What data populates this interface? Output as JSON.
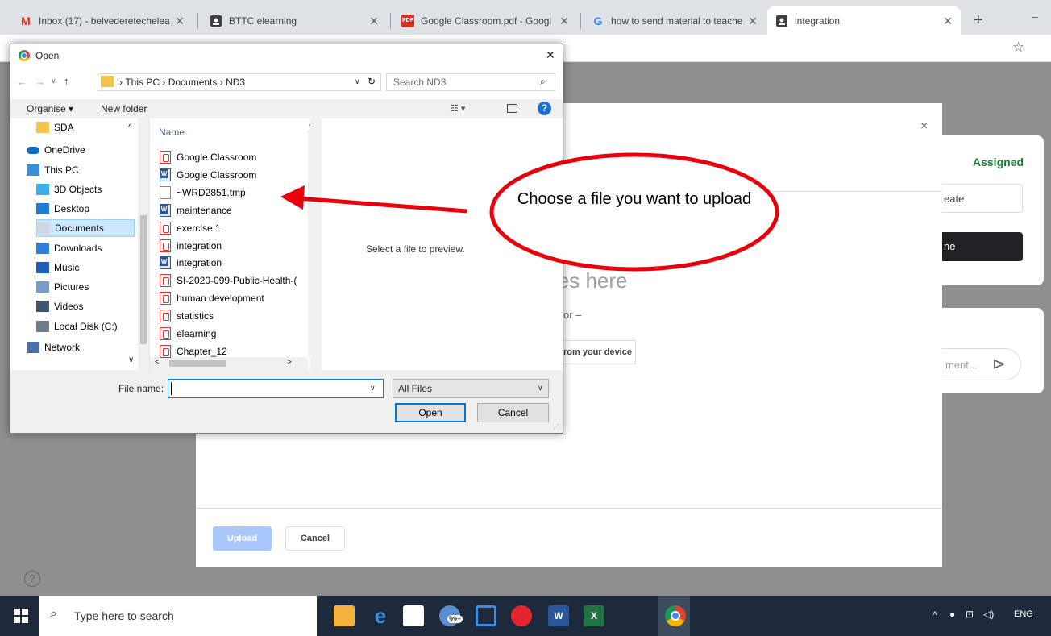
{
  "browser": {
    "tabs": [
      {
        "label": "Inbox (17) - belvederetechelea",
        "icon": "gmail-icon"
      },
      {
        "label": "BTTC elearning",
        "icon": "classroom-icon"
      },
      {
        "label": "Google Classroom.pdf - Googl",
        "icon": "pdf-icon"
      },
      {
        "label": "how to send material to teache",
        "icon": "google-icon"
      },
      {
        "label": "integration",
        "icon": "classroom-icon"
      }
    ],
    "new_tab": "+",
    "minimize": "–",
    "star": "☆"
  },
  "classroom": {
    "assigned": "Assigned",
    "create_partial": "eate",
    "done_partial": "ne",
    "drag_partial": "les here",
    "or_partial": "or –",
    "device_partial": "rom your device",
    "comment_partial": "ment...",
    "upload": "Upload",
    "cancel": "Cancel",
    "close": "×"
  },
  "open_dialog": {
    "title": "Open",
    "close": "✕",
    "breadcrumb": [
      "This PC",
      "Documents",
      "ND3"
    ],
    "search_placeholder": "Search ND3",
    "organise": "Organise ▾",
    "new_folder": "New folder",
    "sidebar": [
      {
        "label": "SDA",
        "icon": "folder-icon",
        "color": "#f4c54a"
      },
      {
        "label": "OneDrive",
        "icon": "onedrive-icon",
        "color": "#0f6cbd"
      },
      {
        "label": "This PC",
        "icon": "pc-icon",
        "color": "#3a8fd8"
      },
      {
        "label": "3D Objects",
        "icon": "cube-icon",
        "color": "#3ab0e6"
      },
      {
        "label": "Desktop",
        "icon": "desktop-icon",
        "color": "#1e7cd4"
      },
      {
        "label": "Documents",
        "icon": "documents-icon",
        "color": "#cfd8e3"
      },
      {
        "label": "Downloads",
        "icon": "download-icon",
        "color": "#2f7fd8"
      },
      {
        "label": "Music",
        "icon": "music-icon",
        "color": "#1d5fb8"
      },
      {
        "label": "Pictures",
        "icon": "pictures-icon",
        "color": "#7a9cc4"
      },
      {
        "label": "Videos",
        "icon": "videos-icon",
        "color": "#40566e"
      },
      {
        "label": "Local Disk (C:)",
        "icon": "disk-icon",
        "color": "#6d7b8a"
      },
      {
        "label": "Network",
        "icon": "network-icon",
        "color": "#4a6fa5"
      }
    ],
    "column_name": "Name",
    "files": [
      {
        "label": "Google Classroom",
        "type": "pdf"
      },
      {
        "label": "Google Classroom",
        "type": "doc"
      },
      {
        "label": "~WRD2851.tmp",
        "type": "tmp"
      },
      {
        "label": "maintenance",
        "type": "doc"
      },
      {
        "label": "exercise 1",
        "type": "pdf"
      },
      {
        "label": "integration",
        "type": "pdf"
      },
      {
        "label": "integration",
        "type": "doc"
      },
      {
        "label": "SI-2020-099-Public-Health-(",
        "type": "pdf"
      },
      {
        "label": "human development",
        "type": "pdf"
      },
      {
        "label": "statistics",
        "type": "pdf"
      },
      {
        "label": "elearning",
        "type": "pdf"
      },
      {
        "label": "Chapter_12",
        "type": "pdf"
      }
    ],
    "preview_text": "Select a file to preview.",
    "file_name_label": "File name:",
    "file_name_value": "",
    "filter": "All Files",
    "open_button": "Open",
    "cancel_button": "Cancel"
  },
  "annotation": {
    "callout": "Choose a file you want to upload",
    "color": "#e8000b"
  },
  "taskbar": {
    "search_placeholder": "Type here to search",
    "store_badge": "99+",
    "lang": "ENG"
  }
}
